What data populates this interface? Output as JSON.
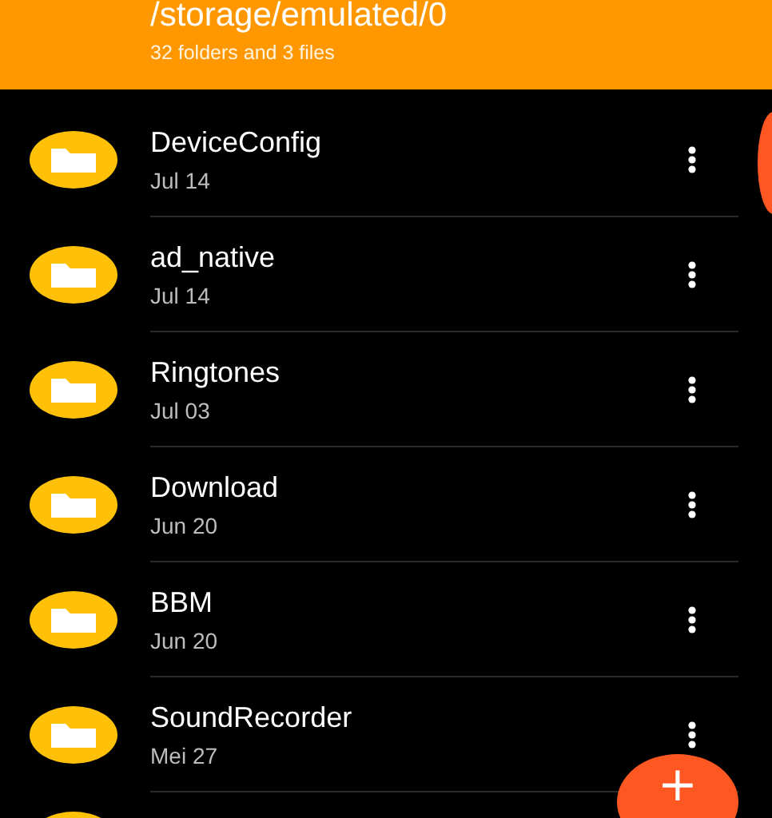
{
  "header": {
    "path": "/storage/emulated/0",
    "summary": "32 folders and 3 files"
  },
  "folders": [
    {
      "name": "DeviceConfig",
      "date": "Jul 14"
    },
    {
      "name": "ad_native",
      "date": "Jul 14"
    },
    {
      "name": "Ringtones",
      "date": "Jul 03"
    },
    {
      "name": "Download",
      "date": "Jun 20"
    },
    {
      "name": "BBM",
      "date": "Jun 20"
    },
    {
      "name": "SoundRecorder",
      "date": "Mei 27"
    }
  ],
  "more_below": true,
  "fab": {
    "label": "+"
  }
}
